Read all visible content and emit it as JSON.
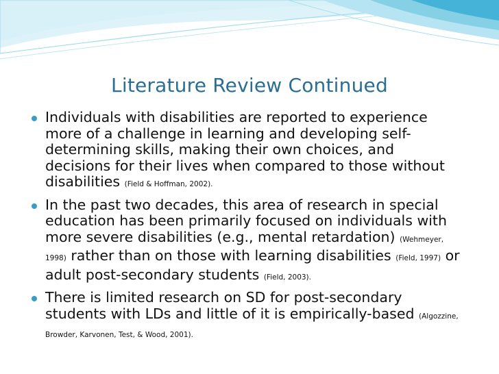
{
  "slide": {
    "title": "Literature Review Continued",
    "bullets": [
      {
        "text": "Individuals with disabilities are reported to experience more of a challenge in learning and developing self-determining skills, making their own choices, and decisions for their lives when compared to those without disabilities",
        "citation": "(Field & Hoffman, 2002)."
      },
      {
        "text_1": "In the past two decades, this area of research in special education has been primarily focused on individuals with more severe disabilities (e.g., mental retardation)",
        "citation_1": "(Wehmeyer, 1998)",
        "text_2": "rather than on those with learning disabilities",
        "citation_2": "(Field, 1997)",
        "text_3": "or adult post-secondary students",
        "citation_3": "(Field, 2003)."
      },
      {
        "text": "There is limited research on SD for post-secondary students with LDs and little of it is empirically-based",
        "citation": "(Algozzine, Browder, Karvonen, Test, & Wood, 2001)."
      }
    ]
  },
  "colors": {
    "title": "#2a6e92",
    "bullet": "#3a9dc8",
    "wave_light": "#cdeef6",
    "wave_mid": "#86d0e6",
    "wave_dark": "#45b3d8"
  }
}
